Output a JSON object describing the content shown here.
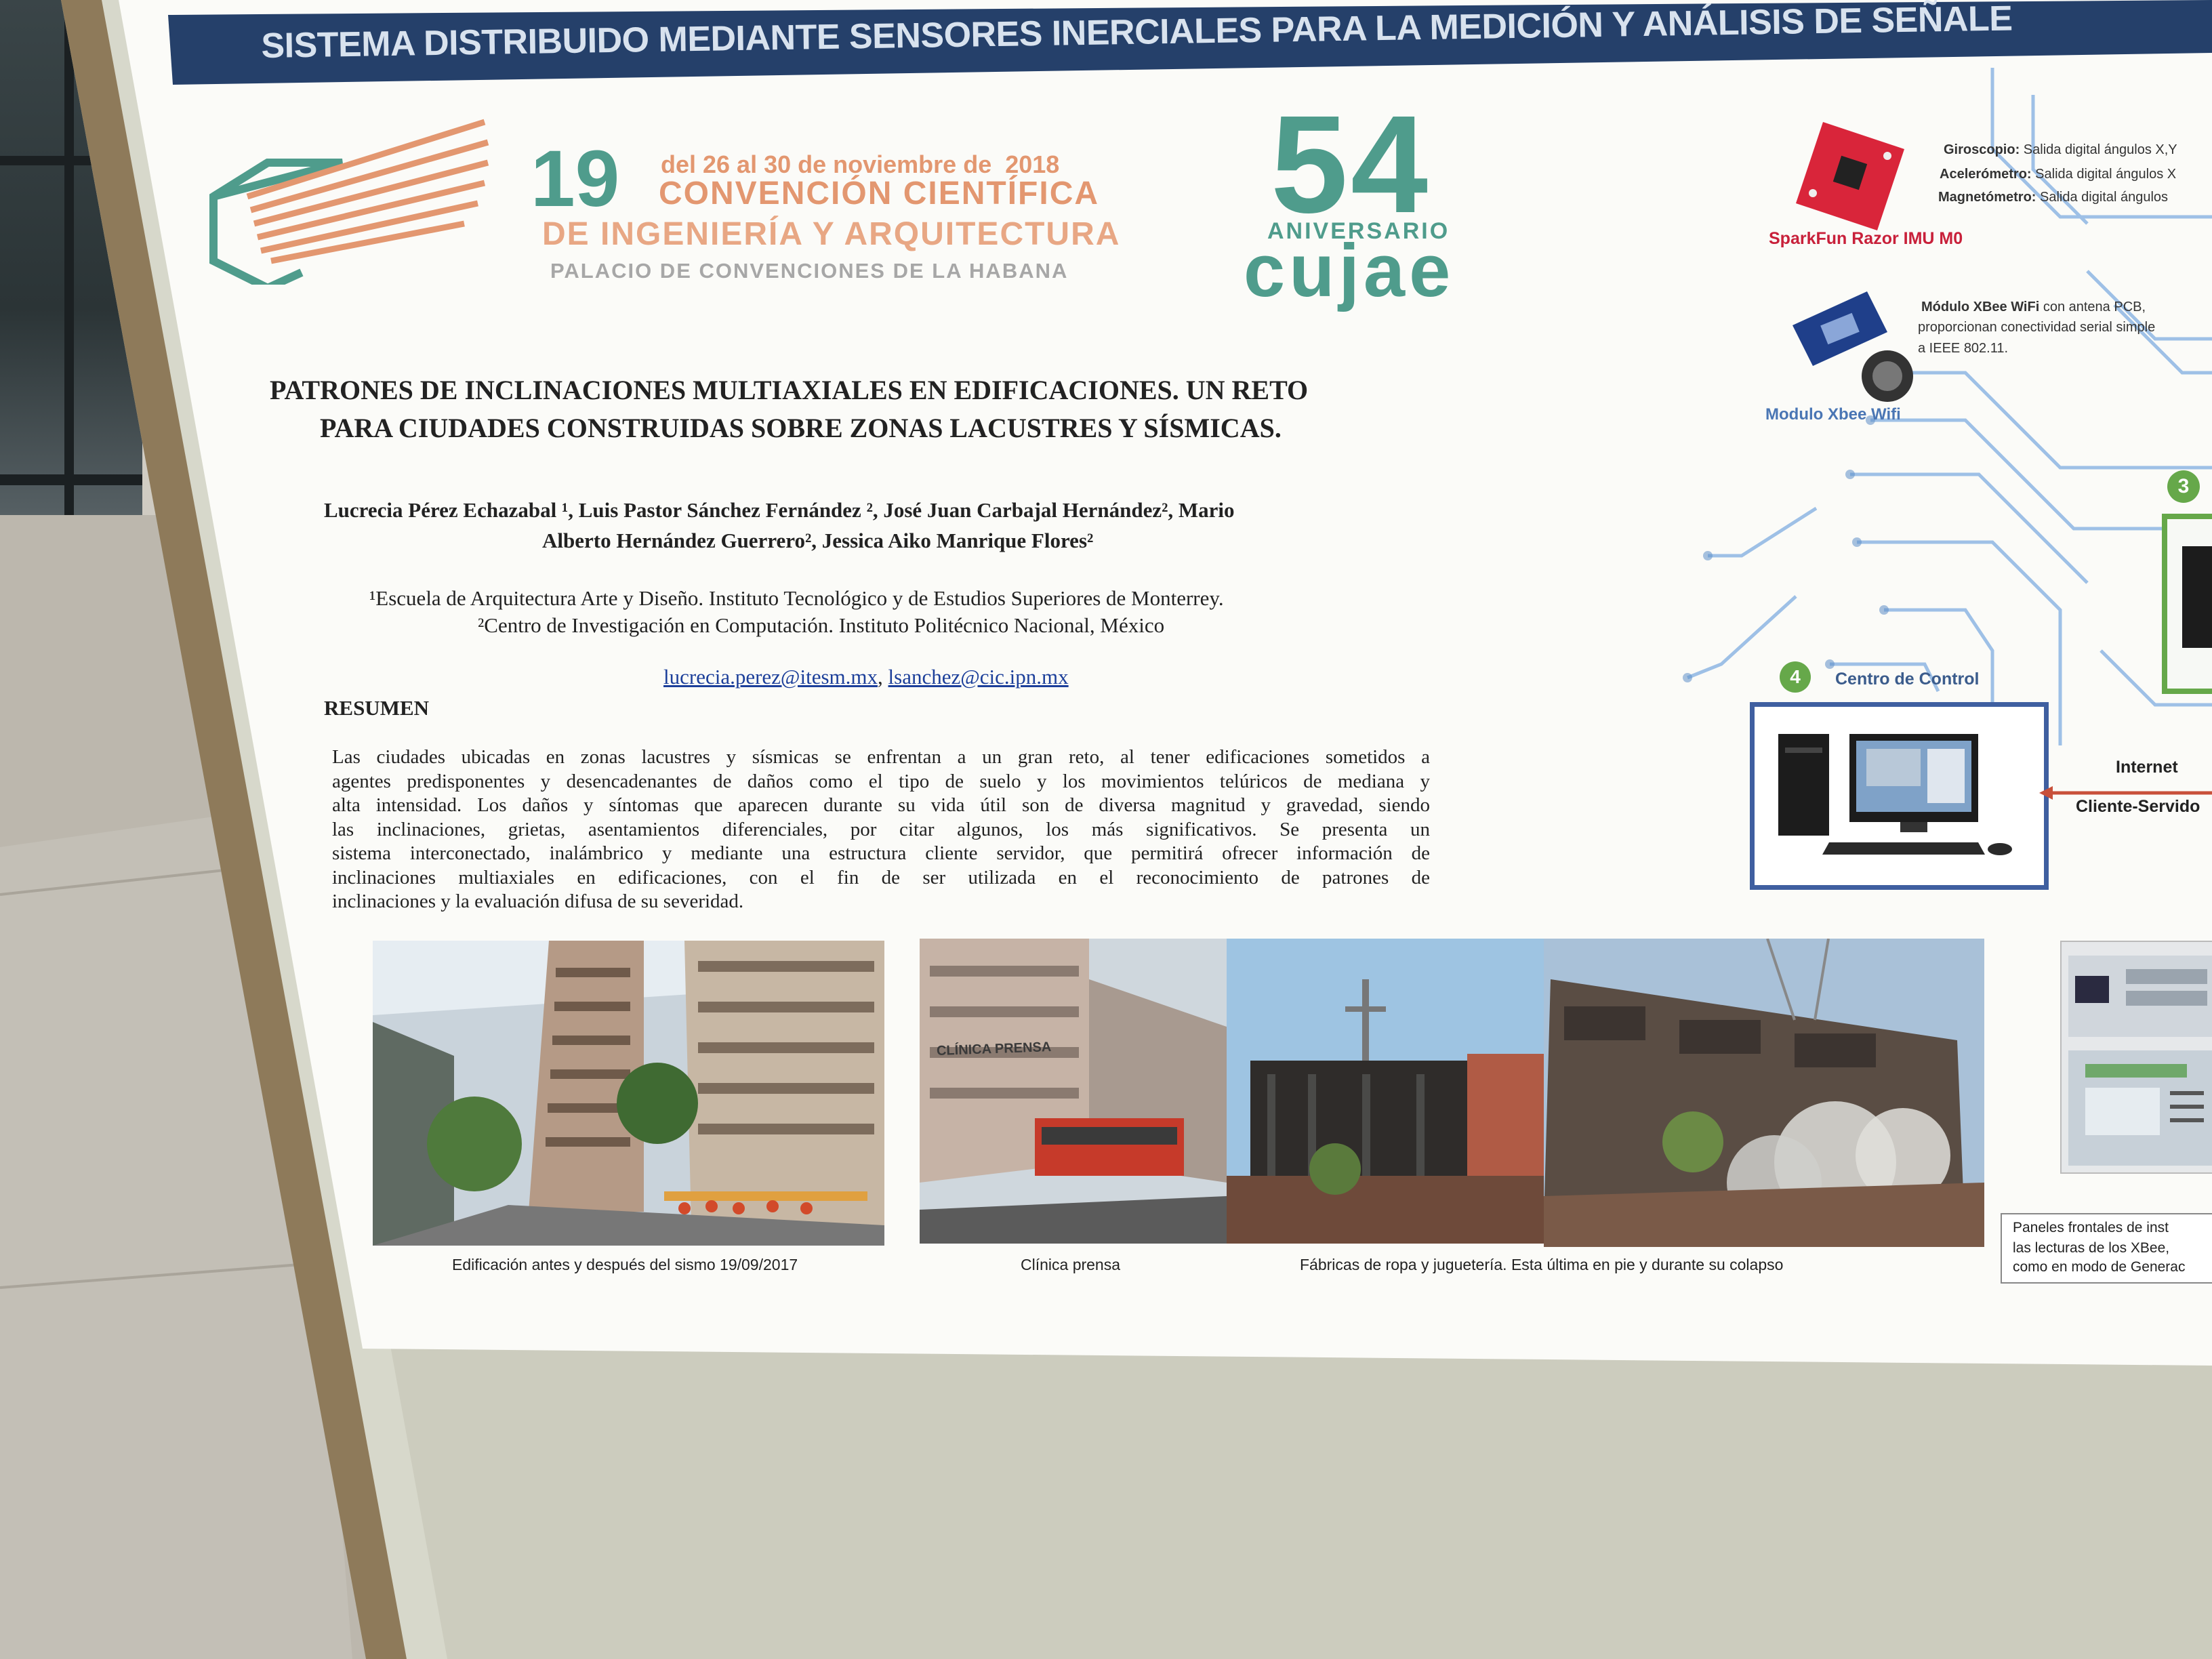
{
  "banner": {
    "title": "SISTEMA DISTRIBUIDO MEDIANTE SENSORES INERCIALES PARA LA MEDICIÓN Y ANÁLISIS DE SEÑALE"
  },
  "event": {
    "number": "19",
    "dates": "del 26 al 30 de noviembre de  2018",
    "line1": "CONVENCIÓN CIENTÍFICA",
    "line2": "DE INGENIERÍA Y ARQUITECTURA",
    "line3": "PALACIO DE CONVENCIONES DE LA HABANA",
    "anniv_number": "54",
    "anniv_label": "ANIVERSARIO",
    "anniv_org": "cujae"
  },
  "paper": {
    "title_line1": "PATRONES DE INCLINACIONES MULTIAXIALES EN EDIFICACIONES. UN RETO",
    "title_line2": "PARA CIUDADES CONSTRUIDAS SOBRE ZONAS LACUSTRES Y SÍSMICAS.",
    "authors_line1": "Lucrecia Pérez Echazabal ¹, Luis Pastor Sánchez Fernández ², José Juan Carbajal Hernández², Mario",
    "authors_line2": "Alberto Hernández Guerrero², Jessica Aiko Manrique Flores²",
    "affil1": "¹Escuela de Arquitectura Arte y Diseño. Instituto Tecnológico y de Estudios Superiores de Monterrey.",
    "affil2": "²Centro de Investigación en Computación. Instituto Politécnico Nacional, México",
    "email1": "lucrecia.perez@itesm.mx",
    "email_sep": ", ",
    "email2": "lsanchez@cic.ipn.mx",
    "abstract_heading": "RESUMEN",
    "abstract_lines": [
      "Las ciudades ubicadas en zonas lacustres y sísmicas se enfrentan a un gran reto, al tener edificaciones sometidos a",
      "agentes predisponentes y desencadenantes de daños como el tipo de suelo y los movimientos telúricos de mediana y",
      "alta intensidad. Los daños y síntomas que aparecen durante su vida útil son de diversa magnitud y gravedad, siendo",
      "las inclinaciones, grietas, asentamientos diferenciales, por citar algunos, los más significativos. Se presenta un",
      "sistema interconectado, inalámbrico y mediante una estructura cliente servidor, que permitirá ofrecer información de",
      "inclinaciones multiaxiales en edificaciones, con el fin de ser utilizada en el reconocimiento de patrones de",
      "inclinaciones y la evaluación difusa de su severidad."
    ]
  },
  "figures": {
    "caption1": "Edificación antes y después del sismo 19/09/2017",
    "caption2": "Clínica prensa",
    "caption3": "Fábricas de ropa y juguetería. Esta última en pie y durante su colapso",
    "bus_sign": "CLÍNICA PRENSA"
  },
  "diagram": {
    "sensor_name": "SparkFun Razor IMU M0",
    "gyro_label": "Giroscopio:",
    "gyro_text": "Salida digital ángulos X,Y",
    "accel_label": "Acelerómetro:",
    "accel_text": "Salida digital ángulos X",
    "mag_label": "Magnetómetro:",
    "mag_text": "Salida digital ángulos",
    "xbee_heading": "Módulo XBee WiFi",
    "xbee_line1": "con antena PCB,",
    "xbee_line2": "proporcionan conectividad serial simple",
    "xbee_line3": "a IEEE 802.11.",
    "xbee_caption": "Modulo Xbee Wifi",
    "step3": "3",
    "step4": "4",
    "control_center": "Centro de Control",
    "internet": "Internet",
    "client_server": "Cliente-Servido"
  },
  "panel_caption": {
    "line1": "Paneles frontales de inst",
    "line2": "las lecturas de los XBee,",
    "line3": "como en modo de Generac"
  },
  "colors": {
    "banner_bg": "#25406a",
    "banner_text": "#d8e2ee",
    "teal": "#4f9c8c",
    "orange": "#e39770",
    "diagram_blue": "#5f8fc8",
    "green_step": "#66a84a"
  }
}
